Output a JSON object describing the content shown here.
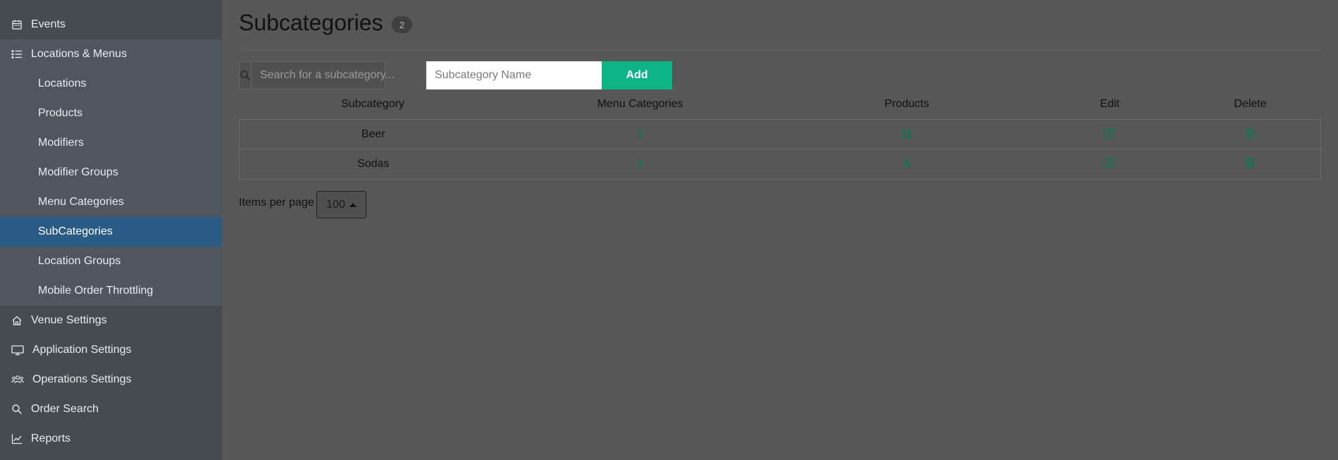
{
  "sidebar": {
    "items": [
      {
        "label": "Events",
        "icon": "calendar-icon"
      },
      {
        "label": "Locations & Menus",
        "icon": "list-icon"
      },
      {
        "label": "Locations"
      },
      {
        "label": "Products"
      },
      {
        "label": "Modifiers"
      },
      {
        "label": "Modifier Groups"
      },
      {
        "label": "Menu Categories"
      },
      {
        "label": "SubCategories"
      },
      {
        "label": "Location Groups"
      },
      {
        "label": "Mobile Order Throttling"
      },
      {
        "label": "Venue Settings",
        "icon": "home-icon"
      },
      {
        "label": "Application Settings",
        "icon": "monitor-icon"
      },
      {
        "label": "Operations Settings",
        "icon": "users-icon"
      },
      {
        "label": "Order Search",
        "icon": "search-icon"
      },
      {
        "label": "Reports",
        "icon": "chart-icon"
      }
    ],
    "active": "SubCategories"
  },
  "header": {
    "title": "Subcategories",
    "count": "2"
  },
  "toolbar": {
    "search_placeholder": "Search for a subcategory...",
    "name_placeholder": "Subcategory Name",
    "add_label": "Add"
  },
  "table": {
    "columns": [
      "Subcategory",
      "Menu Categories",
      "Products",
      "Edit",
      "Delete"
    ],
    "rows": [
      {
        "name": "Beer",
        "menu_categories": "1",
        "products": "11"
      },
      {
        "name": "Sodas",
        "menu_categories": "1",
        "products": "5"
      }
    ]
  },
  "pager": {
    "label": "Items per page",
    "value": "100"
  },
  "colors": {
    "accent": "#0bb385",
    "active_nav": "#2a5b85",
    "link_number": "#0a7a56"
  }
}
